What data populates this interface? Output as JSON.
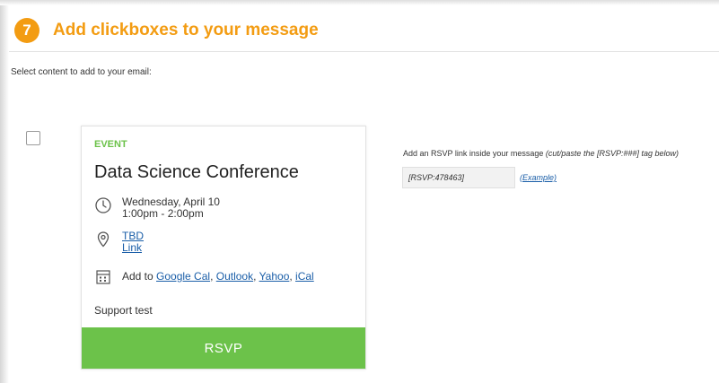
{
  "step": {
    "number": "7",
    "title": "Add clickboxes to your message"
  },
  "instruction": "Select content to add to your email:",
  "event": {
    "label": "EVENT",
    "title": "Data Science Conference",
    "date": "Wednesday, April 10",
    "time": "1:00pm - 2:00pm",
    "location_primary": "TBD",
    "location_secondary": "Link",
    "add_to_prefix": "Add to ",
    "calendars": {
      "google": "Google Cal",
      "outlook": "Outlook",
      "yahoo": "Yahoo",
      "ical": "iCal"
    },
    "separator": ", ",
    "note": "Support test",
    "rsvp_button": "RSVP"
  },
  "rsvp_info": {
    "text": "Add an RSVP link inside your message ",
    "hint": "(cut/paste the [RSVP:###] tag below)",
    "tag_value": "[RSVP:478463]",
    "example_link": "(Example)"
  },
  "colors": {
    "accent_orange": "#f39c12",
    "event_green": "#6cc24a",
    "link_blue": "#1a5ea8"
  },
  "icons": {
    "clock": "clock-icon",
    "location": "map-pin-icon",
    "calendar": "calendar-icon"
  }
}
